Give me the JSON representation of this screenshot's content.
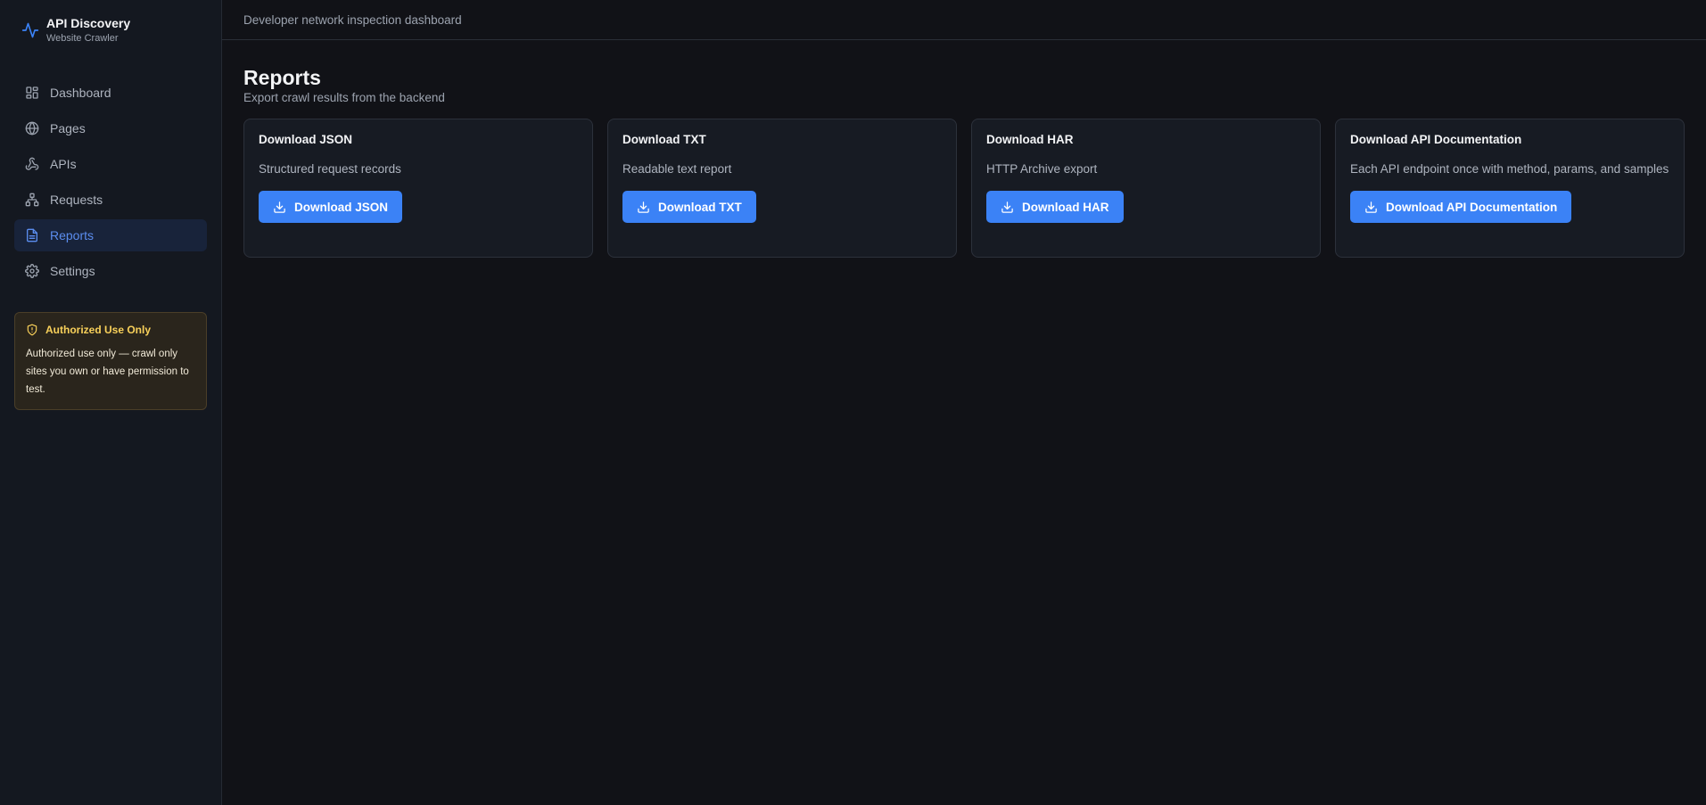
{
  "brand": {
    "title": "API Discovery",
    "subtitle": "Website Crawler",
    "accent": "#3b82f6"
  },
  "sidebar": {
    "items": [
      {
        "label": "Dashboard",
        "icon": "dashboard-icon"
      },
      {
        "label": "Pages",
        "icon": "globe-icon"
      },
      {
        "label": "APIs",
        "icon": "webhook-icon"
      },
      {
        "label": "Requests",
        "icon": "network-icon"
      },
      {
        "label": "Reports",
        "icon": "file-text-icon",
        "active": true
      },
      {
        "label": "Settings",
        "icon": "gear-icon"
      }
    ],
    "notice": {
      "title": "Authorized Use Only",
      "text": "Authorized use only — crawl only sites you own or have permission to test.",
      "color": "#f8d05a"
    }
  },
  "topbar": {
    "text": "Developer network inspection dashboard"
  },
  "page": {
    "title": "Reports",
    "subtitle": "Export crawl results from the backend"
  },
  "cards": [
    {
      "title": "Download JSON",
      "description": "Structured request records",
      "button": "Download JSON"
    },
    {
      "title": "Download TXT",
      "description": "Readable text report",
      "button": "Download TXT"
    },
    {
      "title": "Download HAR",
      "description": "HTTP Archive export",
      "button": "Download HAR"
    },
    {
      "title": "Download API Documentation",
      "description": "Each API endpoint once with method, params, and samples",
      "button": "Download API Documentation"
    }
  ]
}
